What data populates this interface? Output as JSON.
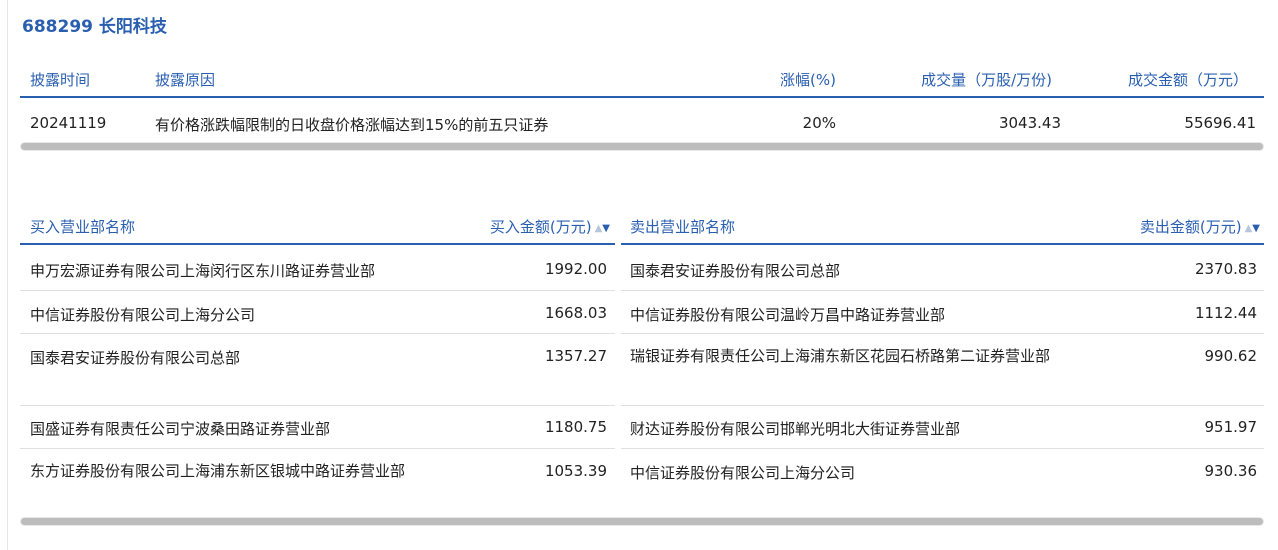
{
  "stock": {
    "title": "688299 长阳科技"
  },
  "disclosure": {
    "headers": {
      "date": "披露时间",
      "reason": "披露原因",
      "change": "涨幅(%)",
      "volume": "成交量（万股/万份)",
      "amount": "成交金额（万元）"
    },
    "row": {
      "date": "20241119",
      "reason": "有价格涨跌幅限制的日收盘价格涨幅达到15%的前五只证券",
      "change": "20%",
      "volume": "3043.43",
      "amount": "55696.41"
    }
  },
  "buy": {
    "header_name": "买入营业部名称",
    "header_amount": "买入金额(万元)",
    "rows": [
      {
        "name": "申万宏源证券有限公司上海闵行区东川路证券营业部",
        "amount": "1992.00"
      },
      {
        "name": "中信证券股份有限公司上海分公司",
        "amount": "1668.03"
      },
      {
        "name": "国泰君安证券股份有限公司总部",
        "amount": "1357.27"
      },
      {
        "name": "国盛证券有限责任公司宁波桑田路证券营业部",
        "amount": "1180.75"
      },
      {
        "name": "东方证券股份有限公司上海浦东新区银城中路证券营业部",
        "amount": "1053.39"
      }
    ]
  },
  "sell": {
    "header_name": "卖出营业部名称",
    "header_amount": "卖出金额(万元)",
    "rows": [
      {
        "name": "国泰君安证券股份有限公司总部",
        "amount": "2370.83"
      },
      {
        "name": "中信证券股份有限公司温岭万昌中路证券营业部",
        "amount": "1112.44"
      },
      {
        "name": "瑞银证券有限责任公司上海浦东新区花园石桥路第二证券营业部",
        "amount": "990.62"
      },
      {
        "name": "财达证券股份有限公司邯郸光明北大街证券营业部",
        "amount": "951.97"
      },
      {
        "name": "中信证券股份有限公司上海分公司",
        "amount": "930.36"
      }
    ]
  },
  "colors": {
    "accent": "#2a5fb0",
    "text": "#222222"
  },
  "icons": {
    "sort": "sort-arrows-icon"
  }
}
